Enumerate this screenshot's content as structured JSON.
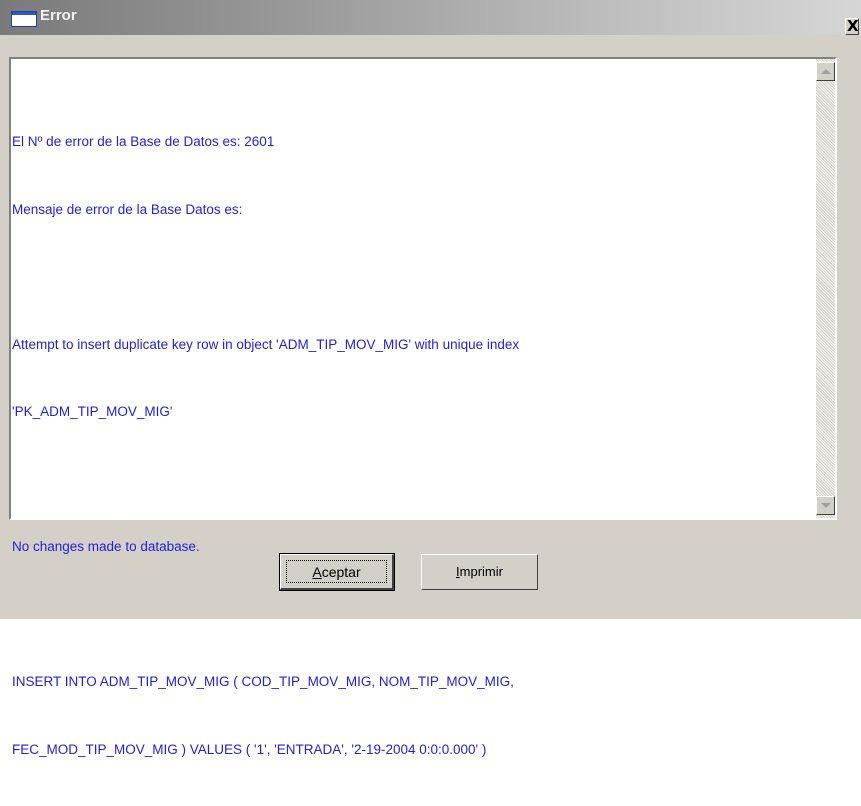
{
  "window": {
    "title": "Error",
    "close_symbol": "X"
  },
  "icons": {
    "app": "window-app-icon",
    "close": "close-icon",
    "scroll_up": "scroll-up-arrow-icon",
    "scroll_down": "scroll-down-arrow-icon"
  },
  "message": {
    "line1": "El Nº de error de la Base de Datos es: 2601",
    "line2": "Mensaje de error de la Base Datos es:",
    "line3": "Attempt to insert duplicate key row in object 'ADM_TIP_MOV_MIG' with unique index",
    "line4": "'PK_ADM_TIP_MOV_MIG'",
    "line5": "No changes made to database.",
    "line6": "INSERT INTO ADM_TIP_MOV_MIG ( COD_TIP_MOV_MIG, NOM_TIP_MOV_MIG,",
    "line7": "FEC_MOD_TIP_MOV_MIG ) VALUES ( '1', 'ENTRADA', '2-19-2004 0:0:0.000' )",
    "text_color": "#1f1fe0"
  },
  "buttons": {
    "accept_first": "A",
    "accept_rest": "ceptar",
    "print_first": "I",
    "print_rest": "mprimir"
  },
  "colors": {
    "dialog_bg": "#d4d0c8",
    "text_blue": "#1f1fe0"
  }
}
